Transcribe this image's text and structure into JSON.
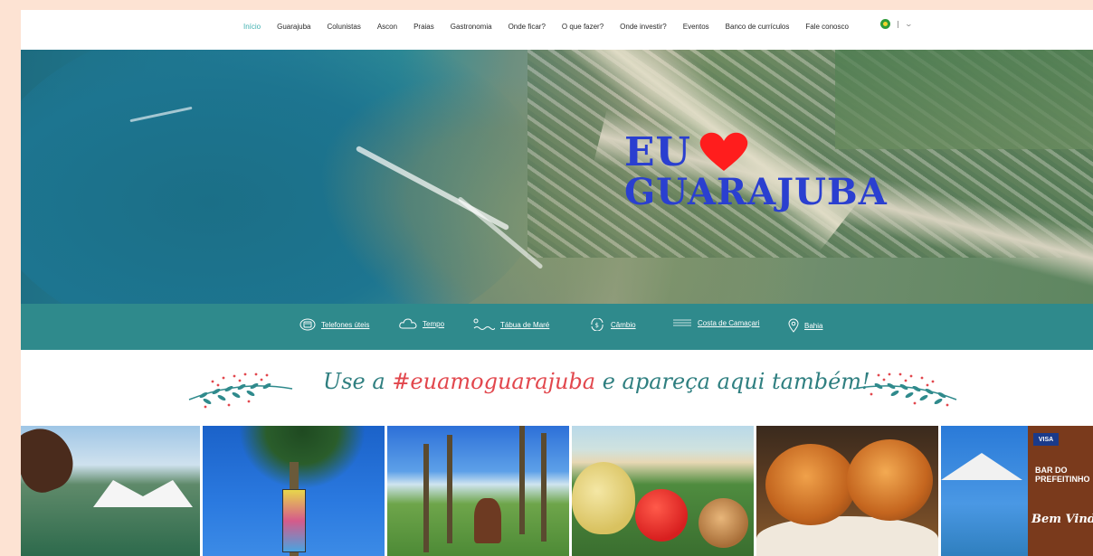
{
  "nav": {
    "items": [
      {
        "label": "Início",
        "active": true
      },
      {
        "label": "Guarajuba",
        "active": false
      },
      {
        "label": "Colunistas",
        "active": false
      },
      {
        "label": "Ascon",
        "active": false
      },
      {
        "label": "Praias",
        "active": false
      },
      {
        "label": "Gastronomia",
        "active": false
      },
      {
        "label": "Onde ficar?",
        "active": false
      },
      {
        "label": "O que fazer?",
        "active": false
      },
      {
        "label": "Onde investir?",
        "active": false
      },
      {
        "label": "Eventos",
        "active": false
      },
      {
        "label": "Banco de currículos",
        "active": false
      },
      {
        "label": "Fale conosco",
        "active": false
      }
    ],
    "language": {
      "flag": "brazil-flag-icon",
      "chevron": "chevron-down-icon"
    }
  },
  "hero": {
    "line1": "EU",
    "line2": "GUARAJUBA",
    "heart_color": "#ff1d1d",
    "text_color": "#2a3fd0"
  },
  "infobar": {
    "items": [
      {
        "label": "Telefones úteis",
        "icon": "telephone-icon"
      },
      {
        "label": "Tempo",
        "icon": "cloud-icon"
      },
      {
        "label": "Tábua de Maré",
        "icon": "tide-wave-icon"
      },
      {
        "label": "Câmbio",
        "icon": "currency-exchange-icon"
      },
      {
        "label": "Costa de Camaçari",
        "icon": "coast-lines-icon"
      },
      {
        "label": "Bahia",
        "icon": "map-pin-icon"
      }
    ],
    "bg_color": "#2f8a8c"
  },
  "banner": {
    "prefix": "Use a ",
    "hashtag": "#euamoguarajuba",
    "suffix": " e apareça aqui também!",
    "text_color": "#2f7f80",
    "hashtag_color": "#e2474d"
  },
  "gallery": {
    "tile6_visa": "VISA",
    "tile6_sign1": "BAR DO PREFEITINHO",
    "tile6_sign2": "Bem Vindo"
  }
}
